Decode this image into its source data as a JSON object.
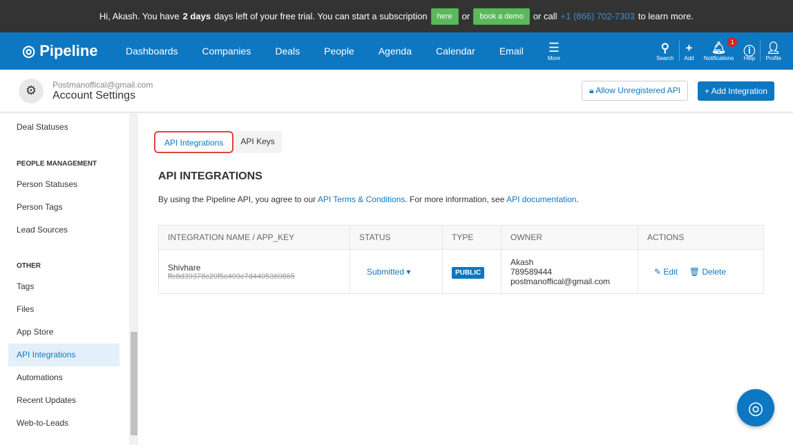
{
  "trial": {
    "pre": "Hi, Akash. You have",
    "days": "2 days",
    "post": "days left of your free trial. You can start a subscription",
    "here": "here",
    "or": "or",
    "demo": "book a demo",
    "call": "or call",
    "phone": "+1 (866) 702-7303",
    "learn": "to learn more."
  },
  "nav": {
    "brand": "Pipeline",
    "items": [
      "Dashboards",
      "Companies",
      "Deals",
      "People",
      "Agenda",
      "Calendar",
      "Email"
    ],
    "more": "More",
    "search": "Search",
    "add": "Add",
    "notifications": "Notifications",
    "notif_count": "1",
    "help": "Help",
    "profile": "Profile"
  },
  "account": {
    "email": "Postmanoffical@gmail.com",
    "title": "Account Settings",
    "allow": "Allow Unregistered API",
    "add": "+ Add Integration"
  },
  "sidebar": {
    "deal_statuses": "Deal Statuses",
    "people_header": "PEOPLE MANAGEMENT",
    "person_statuses": "Person Statuses",
    "person_tags": "Person Tags",
    "lead_sources": "Lead Sources",
    "other_header": "OTHER",
    "tags": "Tags",
    "files": "Files",
    "app_store": "App Store",
    "api_integrations": "API Integrations",
    "automations": "Automations",
    "recent_updates": "Recent Updates",
    "web_to_leads": "Web-to-Leads"
  },
  "main": {
    "tabs": [
      "API Integrations",
      "API Keys"
    ],
    "heading": "API INTEGRATIONS",
    "desc_pre": "By using the Pipeline API, you agree to our",
    "terms": "API Terms & Conditions",
    "desc_mid": ". For more information, see",
    "docs": "API documentation",
    "desc_end": ".",
    "columns": [
      "INTEGRATION NAME / APP_KEY",
      "STATUS",
      "TYPE",
      "OWNER",
      "ACTIONS"
    ],
    "row": {
      "name": "Shivhare",
      "key": "ffc8d39378c20f5c409c7d4405369865",
      "status": "Submitted",
      "type": "PUBLIC",
      "owner_name": "Akash",
      "owner_phone": "789589444",
      "owner_email": "postmanoffical@gmail.com",
      "edit": "Edit",
      "delete": "Delete"
    }
  }
}
